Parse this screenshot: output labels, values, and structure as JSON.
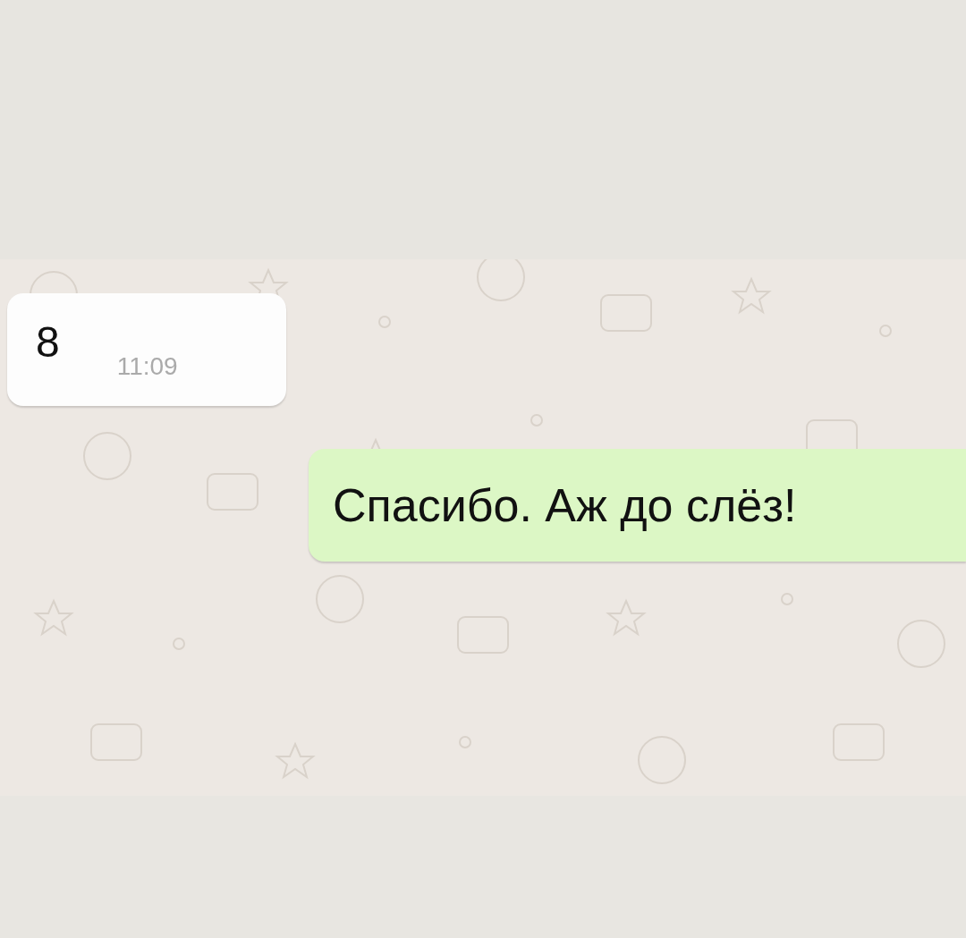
{
  "messages": [
    {
      "kind": "incoming",
      "text": "8",
      "time": "11:09"
    },
    {
      "kind": "outgoing",
      "text": "Спасибо. Аж до слёз!"
    }
  ]
}
